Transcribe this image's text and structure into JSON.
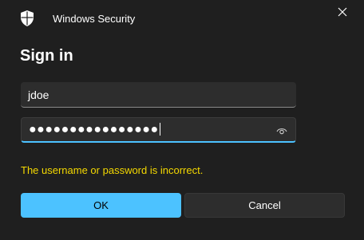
{
  "window": {
    "title": "Windows Security",
    "icon": "shield-icon",
    "close_icon": "close-icon"
  },
  "dialog": {
    "heading": "Sign in",
    "username_value": "jdoe",
    "password_mask": "●●●●●●●●●●●●●●●●",
    "reveal_icon": "eye-icon",
    "error_message": "The username or password is incorrect."
  },
  "buttons": {
    "ok_label": "OK",
    "cancel_label": "Cancel"
  },
  "colors": {
    "background": "#1f1f1f",
    "accent": "#4cc2ff",
    "error": "#f4d800"
  }
}
